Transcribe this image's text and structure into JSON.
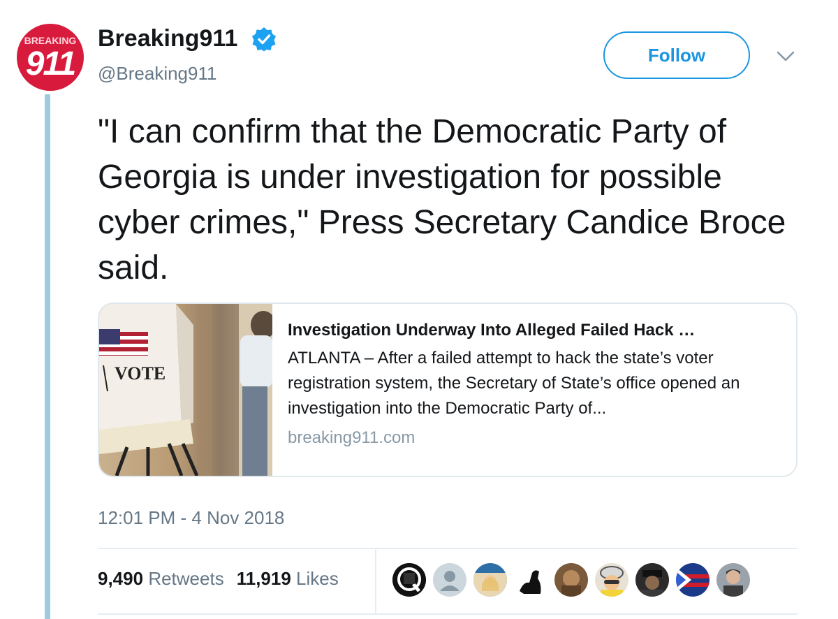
{
  "author": {
    "avatar_text_top": "BREAKING",
    "avatar_text_main": "911",
    "name": "Breaking911",
    "handle": "@Breaking911",
    "verified": true
  },
  "follow_label": "Follow",
  "tweet_text": "\"I can confirm that the Democratic Party of Georgia is under investigation for possible cyber crimes,\" Press Secretary Candice Broce said.",
  "card": {
    "image_sign_text": "VOTE",
    "title": "Investigation Underway Into Alleged Failed Hack …",
    "description": "ATLANTA – After a failed attempt to hack the state’s voter registration system, the Secretary of State’s office opened an investigation into the Democratic Party of...",
    "domain": "breaking911.com"
  },
  "timestamp": "12:01 PM - 4 Nov 2018",
  "stats": {
    "retweets_count": "9,490",
    "retweets_label": "Retweets",
    "likes_count": "11,919",
    "likes_label": "Likes"
  },
  "likers": [
    {
      "icon": "q-avatar"
    },
    {
      "icon": "default-avatar"
    },
    {
      "icon": "photo-avatar"
    },
    {
      "icon": "silhouette-avatar"
    },
    {
      "icon": "photo-avatar"
    },
    {
      "icon": "photo-avatar"
    },
    {
      "icon": "photo-avatar"
    },
    {
      "icon": "flag-avatar"
    },
    {
      "icon": "photo-avatar"
    }
  ],
  "colors": {
    "accent": "#1b95e0",
    "verified": "#1da1f2",
    "thread_line": "#9ecbe0",
    "muted_text": "#657786",
    "avatar_bg": "#d81b3c"
  }
}
